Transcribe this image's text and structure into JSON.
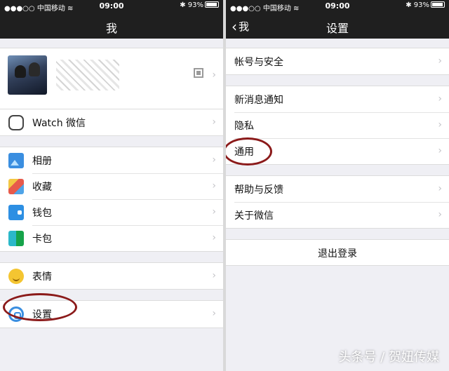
{
  "left": {
    "status": {
      "signal": "●●●○○",
      "carrier": "中国移动",
      "wifi": "≋",
      "time": "09:00",
      "bluetooth": "✱",
      "battery": "93%"
    },
    "nav": {
      "title": "我"
    },
    "watch_label": "Watch 微信",
    "group1": [
      {
        "icon": "album-icon",
        "label": "相册"
      },
      {
        "icon": "favorites-icon",
        "label": "收藏"
      },
      {
        "icon": "wallet-icon",
        "label": "钱包"
      },
      {
        "icon": "card-icon",
        "label": "卡包"
      }
    ],
    "emoji_label": "表情",
    "settings_label": "设置"
  },
  "right": {
    "status": {
      "signal": "●●●○○",
      "carrier": "中国移动",
      "wifi": "≋",
      "time": "09:00",
      "bluetooth": "✱",
      "battery": "93%"
    },
    "nav": {
      "back_label": "我",
      "title": "设置"
    },
    "account_label": "帐号与安全",
    "group2": [
      "新消息通知",
      "隐私",
      "通用"
    ],
    "group3": [
      "帮助与反馈",
      "关于微信"
    ],
    "logout_label": "退出登录"
  },
  "watermark": "头条号 / 贺妞传媒",
  "colors": {
    "nav_bg": "#1f1f1f",
    "page_bg": "#efeff4",
    "highlight": "#8b1a1a"
  },
  "chevron": "›"
}
